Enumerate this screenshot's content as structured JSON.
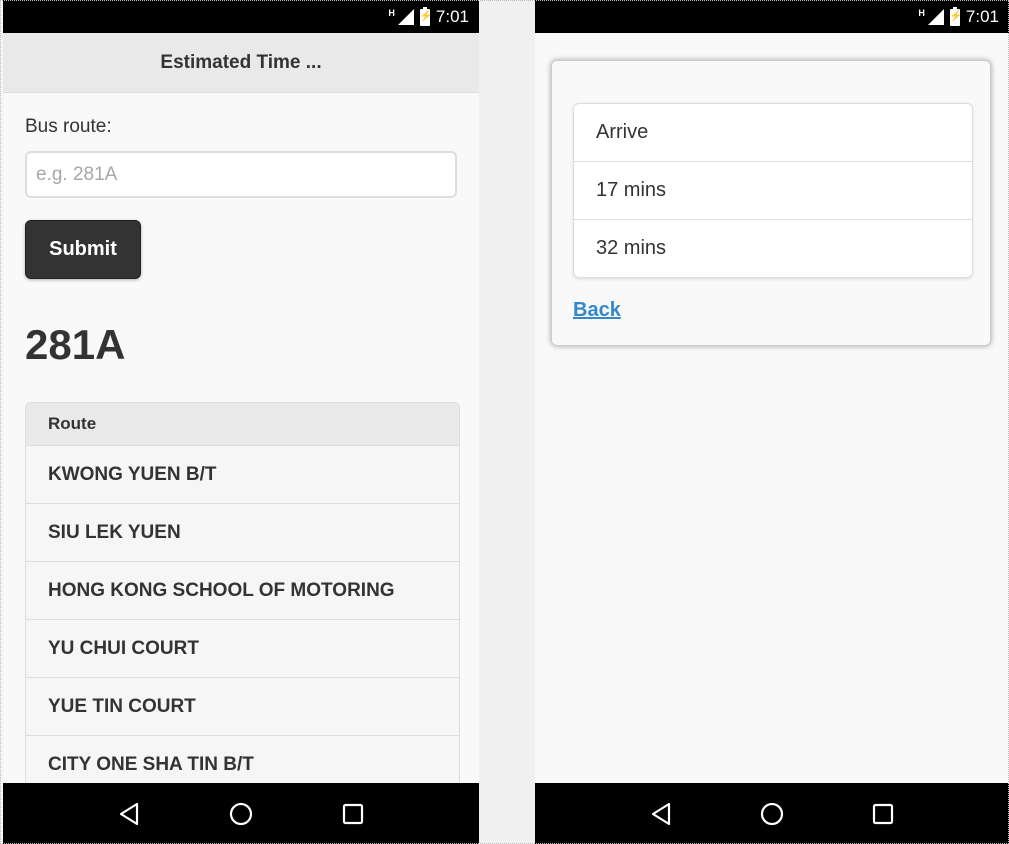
{
  "status_bar": {
    "network": "H",
    "time": "7:01"
  },
  "left": {
    "header_title": "Estimated Time ...",
    "bus_route_label": "Bus route:",
    "bus_route_input": {
      "value": "",
      "placeholder": "e.g. 281A"
    },
    "submit_label": "Submit",
    "route_heading": "281A",
    "list": {
      "header": "Route",
      "items": [
        "KWONG YUEN B/T",
        "SIU LEK YUEN",
        "HONG KONG SCHOOL OF MOTORING",
        "YU CHUI COURT",
        "YUE TIN COURT",
        "CITY ONE SHA TIN B/T"
      ]
    }
  },
  "right": {
    "eta_items": [
      "Arrive",
      "17 mins",
      "32 mins"
    ],
    "back_label": "Back"
  },
  "nav_icons": [
    "back-triangle-icon",
    "home-circle-icon",
    "recents-square-icon"
  ],
  "colors": {
    "link": "#3388cc",
    "button": "#333333",
    "header": "#e9e9e9",
    "bars": "#000000"
  }
}
